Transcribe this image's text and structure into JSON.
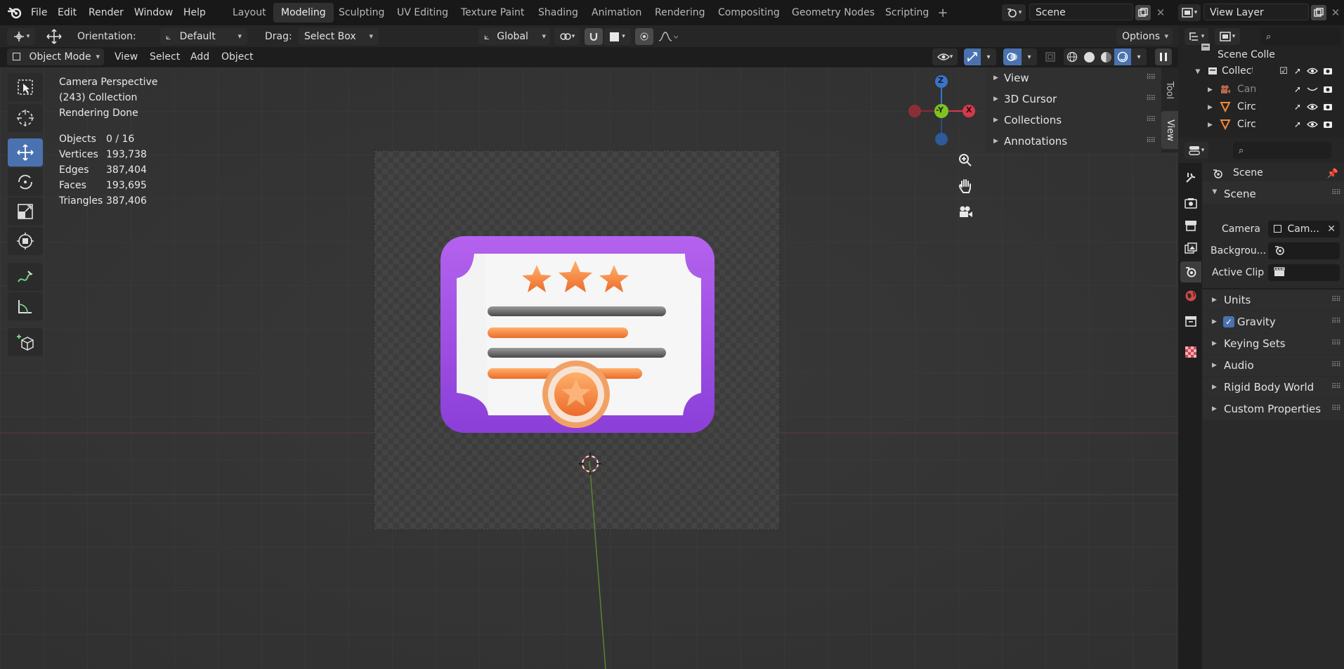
{
  "menubar": {
    "file": "File",
    "edit": "Edit",
    "render": "Render",
    "window": "Window",
    "help": "Help"
  },
  "workspaces": [
    "Layout",
    "Modeling",
    "Sculpting",
    "UV Editing",
    "Texture Paint",
    "Shading",
    "Animation",
    "Rendering",
    "Compositing",
    "Geometry Nodes",
    "Scripting"
  ],
  "active_workspace": "Modeling",
  "scene_field": "Scene",
  "view_layer_field": "View Layer",
  "tool_header": {
    "orientation_label": "Orientation:",
    "orientation_value": "Default",
    "drag_label": "Drag:",
    "drag_value": "Select Box",
    "transform_orientation": "Global",
    "options": "Options"
  },
  "view_header": {
    "mode": "Object Mode",
    "view": "View",
    "select": "Select",
    "add": "Add",
    "object": "Object"
  },
  "overlay_info": {
    "camera": "Camera Perspective",
    "collection": "(243) Collection",
    "status": "Rendering Done",
    "stats": [
      {
        "label": "Objects",
        "value": "0 / 16"
      },
      {
        "label": "Vertices",
        "value": "193,738"
      },
      {
        "label": "Edges",
        "value": "387,404"
      },
      {
        "label": "Faces",
        "value": "193,695"
      },
      {
        "label": "Triangles",
        "value": "387,406"
      }
    ]
  },
  "gizmo": {
    "z": "Z",
    "y": "-Y",
    "x": "X"
  },
  "n_panel": {
    "items": [
      "View",
      "3D Cursor",
      "Collections",
      "Annotations"
    ],
    "tabs": [
      "Tool",
      "View"
    ]
  },
  "outliner": {
    "root": "Scene Colle",
    "collection": "Collectio",
    "items": [
      "Can",
      "Circ",
      "Circ"
    ]
  },
  "properties": {
    "context_title": "Scene",
    "panel_title": "Scene",
    "camera_label": "Camera",
    "camera_value": "Cam...",
    "background_label": "Backgrou...",
    "active_clip_label": "Active Clip",
    "sections": [
      "Units",
      "Gravity",
      "Keying Sets",
      "Audio",
      "Rigid Body World",
      "Custom Properties"
    ],
    "gravity_checked": true
  },
  "colors": {
    "accent_blue": "#4a72b0",
    "axis_x": "#d53a4b",
    "axis_y": "#7ec324",
    "axis_z": "#3a74c7",
    "card_purple": "#a24ee6",
    "star_orange": "#f08a3a"
  }
}
